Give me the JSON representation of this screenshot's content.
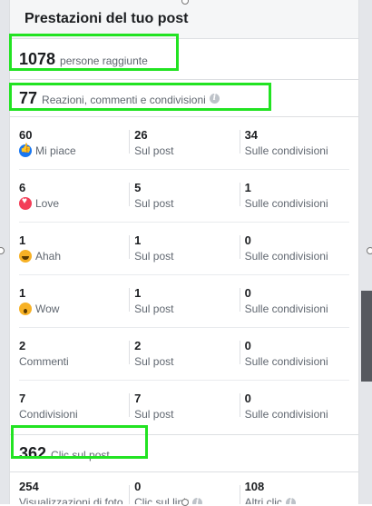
{
  "header": {
    "title": "Prestazioni del tuo post"
  },
  "reach": {
    "value": "1078",
    "label": "persone raggiunte"
  },
  "engagement": {
    "value": "77",
    "label": "Reazioni, commenti e condivisioni",
    "info_icon": "info-icon"
  },
  "columns": [
    "Sul post",
    "Sulle condivisioni"
  ],
  "rows": [
    {
      "total": "60",
      "label": "Mi piace",
      "icon": "like-icon",
      "on_post": "26",
      "on_shares": "34"
    },
    {
      "total": "6",
      "label": "Love",
      "icon": "love-icon",
      "on_post": "5",
      "on_shares": "1"
    },
    {
      "total": "1",
      "label": "Ahah",
      "icon": "haha-icon",
      "on_post": "1",
      "on_shares": "0"
    },
    {
      "total": "1",
      "label": "Wow",
      "icon": "wow-icon",
      "on_post": "1",
      "on_shares": "0"
    },
    {
      "total": "2",
      "label": "Commenti",
      "icon": "",
      "on_post": "2",
      "on_shares": "0"
    },
    {
      "total": "7",
      "label": "Condivisioni",
      "icon": "",
      "on_post": "7",
      "on_shares": "0"
    }
  ],
  "clicks": {
    "value": "362",
    "label": "Clic sul post"
  },
  "click_breakdown": [
    {
      "value": "254",
      "label": "Visualizzazioni di foto",
      "info": false
    },
    {
      "value": "0",
      "label": "Clic sul link",
      "info": true
    },
    {
      "value": "108",
      "label": "Altri clic",
      "info": true
    }
  ],
  "colors": {
    "highlight": "#22e322",
    "like": "#1877f2",
    "love": "#f33e58",
    "haha_wow": "#f7b125"
  }
}
